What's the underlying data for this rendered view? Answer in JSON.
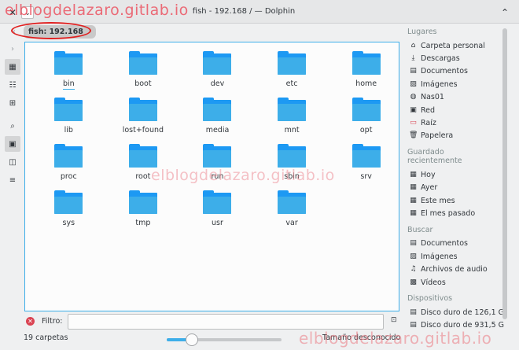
{
  "window": {
    "title": "fish - 192.168        / — Dolphin",
    "close_glyph": "✕",
    "menu_glyph": "⌄",
    "collapse_glyph": "⌃"
  },
  "watermark": {
    "text": "elblogdelazaro.gitlab.io"
  },
  "location": {
    "path": "fish: 192.168"
  },
  "toolbar": {
    "icons": [
      "icons-view-icon",
      "compact-view-icon",
      "details-view-icon",
      "search-icon",
      "preview-icon",
      "split-icon",
      "menu-icon"
    ]
  },
  "folders": [
    {
      "name": "bin"
    },
    {
      "name": "boot"
    },
    {
      "name": "dev"
    },
    {
      "name": "etc"
    },
    {
      "name": "home"
    },
    {
      "name": "lib"
    },
    {
      "name": "lost+found"
    },
    {
      "name": "media"
    },
    {
      "name": "mnt"
    },
    {
      "name": "opt"
    },
    {
      "name": "proc"
    },
    {
      "name": "root"
    },
    {
      "name": "run"
    },
    {
      "name": "sbin"
    },
    {
      "name": "srv"
    },
    {
      "name": "sys"
    },
    {
      "name": "tmp"
    },
    {
      "name": "usr"
    },
    {
      "name": "var"
    }
  ],
  "filter": {
    "label": "Filtro:",
    "value": ""
  },
  "status": {
    "count": "19 carpetas",
    "free_space": "Tamaño desconocido",
    "zoom_fraction": 0.22
  },
  "places": {
    "sections": [
      {
        "title": "Lugares",
        "items": [
          {
            "label": "Carpeta personal",
            "icon": "⌂",
            "red": false
          },
          {
            "label": "Descargas",
            "icon": "⤓",
            "red": false
          },
          {
            "label": "Documentos",
            "icon": "▤",
            "red": false
          },
          {
            "label": "Imágenes",
            "icon": "▨",
            "red": false
          },
          {
            "label": "Nas01",
            "icon": "◍",
            "red": false
          },
          {
            "label": "Red",
            "icon": "▣",
            "red": false
          },
          {
            "label": "Raíz",
            "icon": "▭",
            "red": true
          },
          {
            "label": "Papelera",
            "icon": "🗑",
            "red": false
          }
        ]
      },
      {
        "title": "Guardado recientemente",
        "items": [
          {
            "label": "Hoy",
            "icon": "▦",
            "red": false
          },
          {
            "label": "Ayer",
            "icon": "▦",
            "red": false
          },
          {
            "label": "Este mes",
            "icon": "▦",
            "red": false
          },
          {
            "label": "El mes pasado",
            "icon": "▦",
            "red": false
          }
        ]
      },
      {
        "title": "Buscar",
        "items": [
          {
            "label": "Documentos",
            "icon": "▤",
            "red": false
          },
          {
            "label": "Imágenes",
            "icon": "▨",
            "red": false
          },
          {
            "label": "Archivos de audio",
            "icon": "♫",
            "red": false
          },
          {
            "label": "Vídeos",
            "icon": "▩",
            "red": false
          }
        ]
      },
      {
        "title": "Dispositivos",
        "items": [
          {
            "label": "Disco duro de 126,1 G",
            "icon": "▤",
            "red": false
          },
          {
            "label": "Disco duro de 931,5 G",
            "icon": "▤",
            "red": false
          }
        ]
      }
    ]
  }
}
